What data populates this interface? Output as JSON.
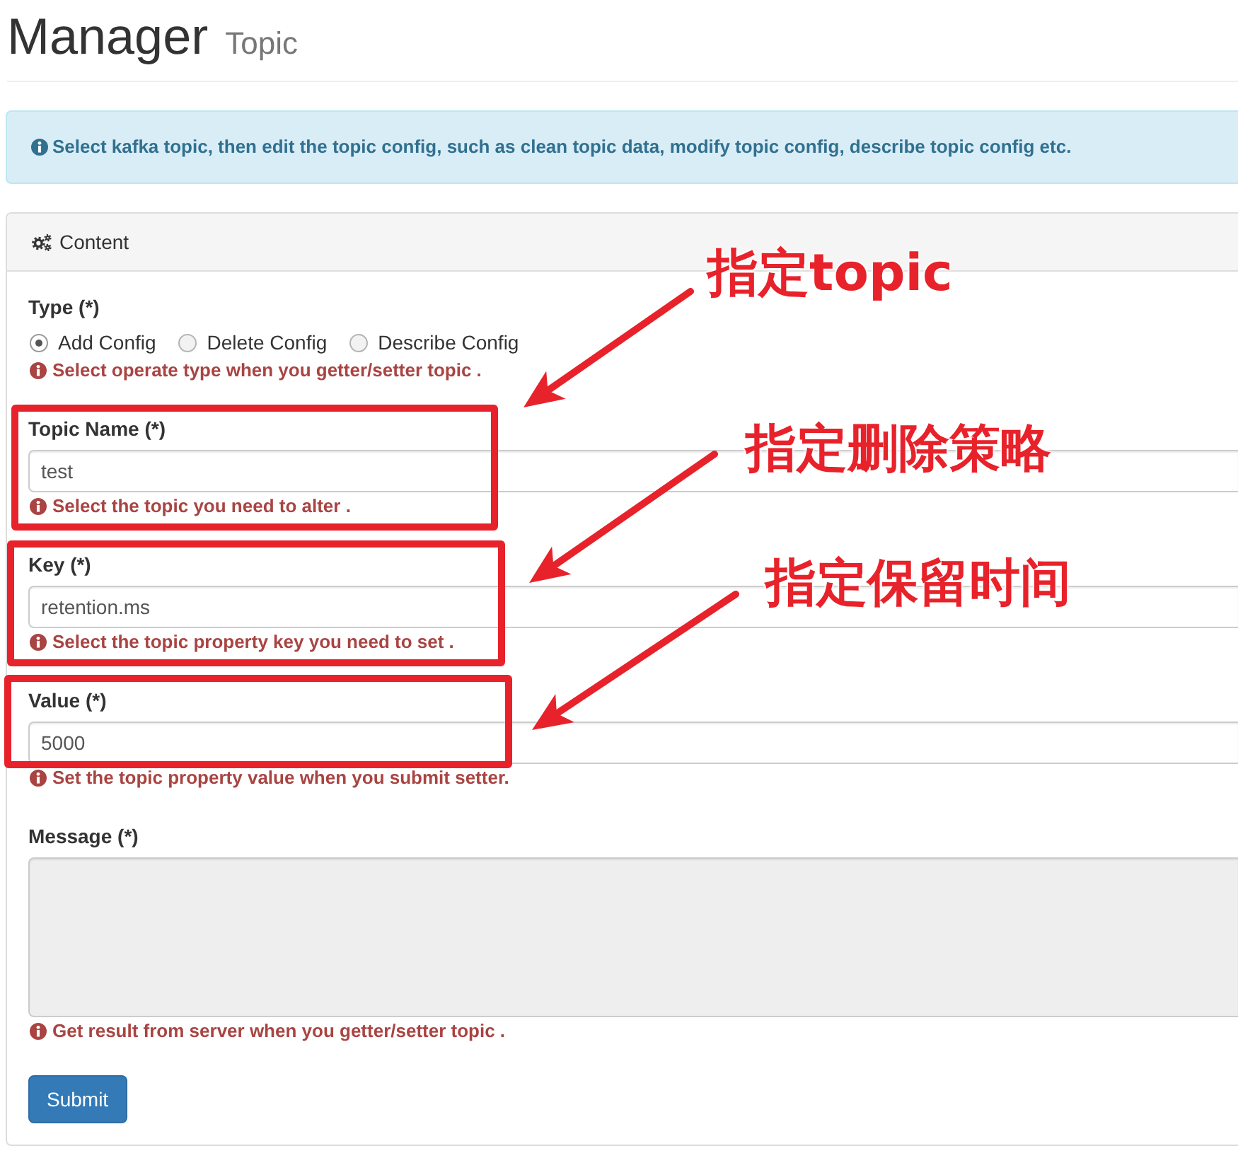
{
  "page_header": {
    "title": "Manager",
    "subtitle": "Topic"
  },
  "alert": {
    "text": "Select kafka topic, then edit the topic config, such as clean topic data, modify topic config, describe topic config etc."
  },
  "panel": {
    "title": "Content"
  },
  "type_group": {
    "label": "Type (*)",
    "options": [
      {
        "label": "Add Config",
        "selected": true
      },
      {
        "label": "Delete Config",
        "selected": false
      },
      {
        "label": "Describe Config",
        "selected": false
      }
    ],
    "help": "Select operate type when you getter/setter topic ."
  },
  "fields": [
    {
      "kind": "input",
      "label": "Topic Name (*)",
      "value": "test",
      "disabled": false,
      "help": "Select the topic you need to alter ."
    },
    {
      "kind": "input",
      "label": "Key (*)",
      "value": "retention.ms",
      "disabled": false,
      "help": "Select the topic property key you need to set ."
    },
    {
      "kind": "input",
      "label": "Value (*)",
      "value": "5000",
      "disabled": false,
      "help": "Set the topic property value when you submit setter."
    },
    {
      "kind": "textarea",
      "label": "Message (*)",
      "disabled": true,
      "help": "Get result from server when you getter/setter topic ."
    }
  ],
  "submit_button": "Submit",
  "annotations": [
    {
      "text": "指定topic"
    },
    {
      "text": "指定删除策略"
    },
    {
      "text": "指定保留时间"
    }
  ]
}
